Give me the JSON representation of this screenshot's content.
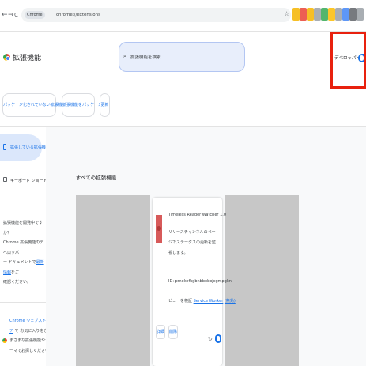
{
  "browser": {
    "back_glyph": "←",
    "forward_glyph": "→",
    "reload_glyph": "C",
    "site_chip": "Chrome",
    "url": "chrome://extensions",
    "star_glyph": "☆",
    "extension_colors": [
      "#f4b400",
      "#ea4335",
      "#f4b400",
      "#9aa0a6",
      "#34a853",
      "#fbbc04",
      "#9aa0a6",
      "#4285f4",
      "#5f6368",
      "#9aa0a6"
    ]
  },
  "header": {
    "title": "拡張機能",
    "search_placeholder": "拡張機能を検索",
    "developer_mode_label": "デベロッパー モード",
    "developer_mode_on": true
  },
  "actions": [
    {
      "label": "パッケージ化されていない拡張機能を読み込む"
    },
    {
      "label": "拡張機能をパッケージ化"
    },
    {
      "label": "更新"
    }
  ],
  "sidebar": {
    "active_item": "拡張している拡張機能",
    "shortcuts_item": "キーボード ショートカット",
    "help_lines": [
      "拡張機能を開発中ですか？",
      "Chrome 拡張機能のデベロッパ",
      "ー ドキュメントで"
    ],
    "help_link": "最新情報",
    "help_tail": "をご",
    "help_last": "確認ください。",
    "promo_link": "Chrome ウェブストア",
    "promo_rest": "で お気に入りをさまざまな拡張機能やテーマでお探しください"
  },
  "main": {
    "section_title": "すべての拡張機能",
    "extension": {
      "name": "Timeless Reader Watcher 1.0",
      "description": "リリースチャンネルのページでステータスの更新を監視します。",
      "id_line": "ID: pmokefkgbnbbobojcgmpgkn",
      "views_label": "ビューを検証",
      "views_link": "Service Worker",
      "views_inactive": "(無効)",
      "details_button": "詳細",
      "remove_button": "削除",
      "enabled": true
    }
  }
}
